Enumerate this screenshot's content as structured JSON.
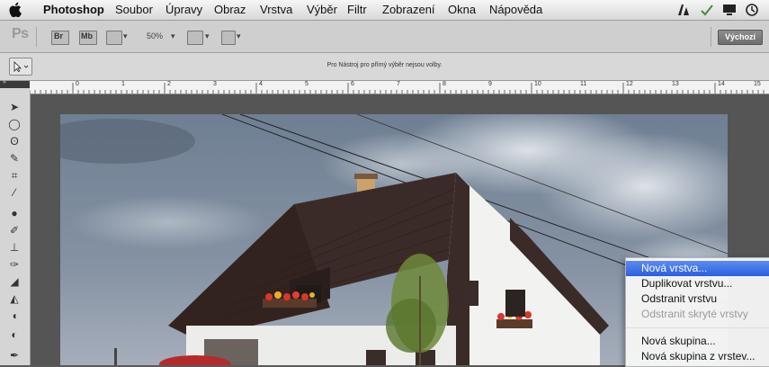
{
  "menubar": {
    "app_name": "Photoshop",
    "items": [
      "Soubor",
      "Úpravy",
      "Obraz",
      "Vrstva",
      "Výběr",
      "Filtr",
      "Zobrazení",
      "Okna",
      "Nápověda"
    ],
    "status_icons": [
      "adobe-icon",
      "checkmark-icon",
      "display-icon",
      "time-machine-icon"
    ]
  },
  "appbar": {
    "logo": "Ps",
    "br_label": "Br",
    "mb_label": "Mb",
    "zoom": "50%",
    "workspace_button": "Výchozí"
  },
  "options_bar": {
    "message": "Pro Nástroj pro přímý výběr nejsou volby."
  },
  "ruler": {
    "labels": [
      "0",
      "1",
      "2",
      "3",
      "4",
      "5",
      "6",
      "7",
      "8",
      "9",
      "10",
      "11",
      "12",
      "13",
      "14",
      "15"
    ]
  },
  "toolbox": {
    "header": "»",
    "tools": [
      "path-selection-icon",
      "ellipse-marquee-icon",
      "lasso-icon",
      "quick-selection-icon",
      "crop-icon",
      "eyedropper-icon",
      "healing-brush-icon",
      "brush-icon",
      "clone-stamp-icon",
      "history-brush-icon",
      "eraser-icon",
      "paint-bucket-icon",
      "blur-icon",
      "dodge-icon",
      "pen-icon"
    ]
  },
  "context_menu": {
    "items": [
      {
        "label": "Nová vrstva...",
        "state": "highlighted"
      },
      {
        "label": "Duplikovat vrstvu...",
        "state": "normal"
      },
      {
        "label": "Odstranit vrstvu",
        "state": "normal"
      },
      {
        "label": "Odstranit skryté vrstvy",
        "state": "disabled"
      },
      {
        "label": "Nová skupina...",
        "state": "normal"
      },
      {
        "label": "Nová skupina z vrstev...",
        "state": "normal"
      }
    ]
  },
  "colors": {
    "highlight": "#2b5fe0",
    "roof": "#3b2b28",
    "wall": "#f2f2f0"
  }
}
